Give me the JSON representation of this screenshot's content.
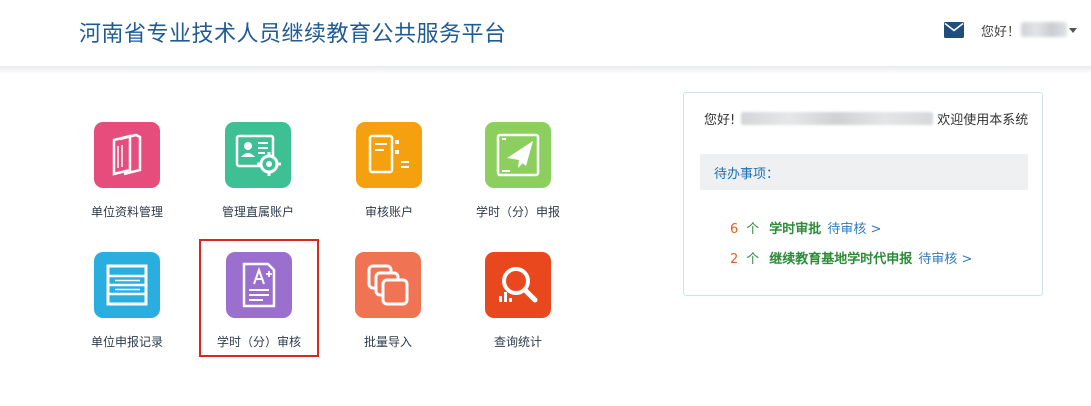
{
  "header": {
    "title": "河南省专业技术人员继续教育公共服务平台",
    "greeting": "您好！",
    "mail_icon": "mail-icon",
    "caret_icon": "caret-down-icon"
  },
  "tiles": [
    {
      "label": "单位资料管理",
      "icon": "documents-icon",
      "color": "#e64d7c"
    },
    {
      "label": "管理直属账户",
      "icon": "id-card-gear-icon",
      "color": "#3fbf94"
    },
    {
      "label": "审核账户",
      "icon": "book-list-icon",
      "color": "#f5a00f"
    },
    {
      "label": "学时（分）申报",
      "icon": "paper-plane-icon",
      "color": "#8ccf5f"
    },
    {
      "label": "单位申报记录",
      "icon": "list-icon",
      "color": "#2aaee0"
    },
    {
      "label": "学时（分）审核",
      "icon": "graded-paper-icon",
      "color": "#9b6fce"
    },
    {
      "label": "批量导入",
      "icon": "stacked-squares-icon",
      "color": "#f07354"
    },
    {
      "label": "查询统计",
      "icon": "search-chart-icon",
      "color": "#e9471e"
    }
  ],
  "panel": {
    "hello": "您好!",
    "welcome_suffix": "欢迎使用本系统",
    "todo_title": "待办事项：",
    "items": [
      {
        "count": "6",
        "unit": "个",
        "name": "学时审批",
        "action": "待审核 >"
      },
      {
        "count": "2",
        "unit": "个",
        "name": "继续教育基地学时代申报",
        "action": "待审核 >"
      }
    ]
  },
  "colors": {
    "title": "#1f5b94",
    "highlight": "#d9281f",
    "count": "#e8601c",
    "item": "#2e8b3a",
    "link": "#2f7bbf"
  }
}
